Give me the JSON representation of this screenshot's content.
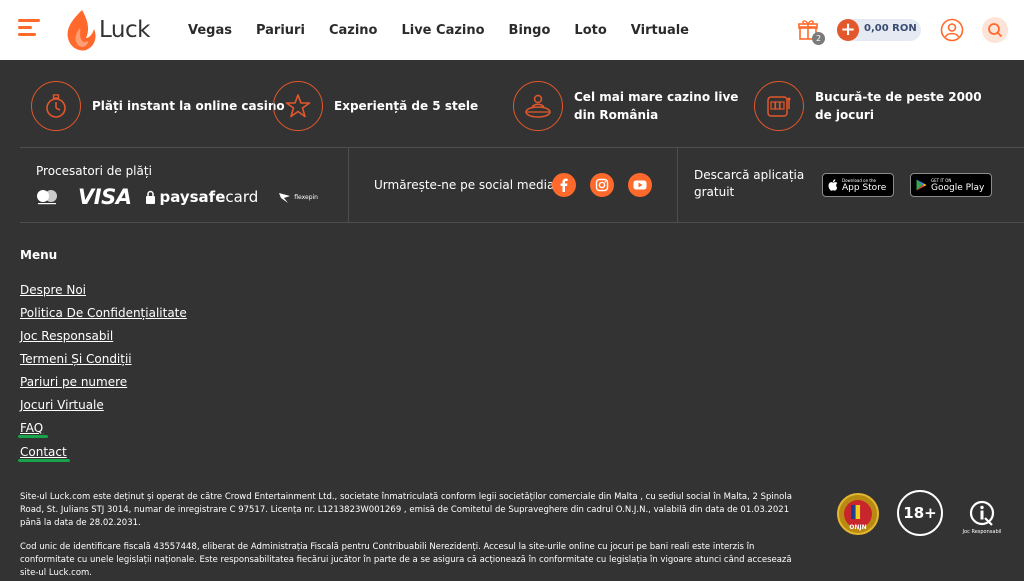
{
  "header": {
    "logo_text": "Luck",
    "nav": [
      "Vegas",
      "Pariuri",
      "Cazino",
      "Live Cazino",
      "Bingo",
      "Loto",
      "Virtuale"
    ],
    "gift_count": "2",
    "balance": "0,00 RON"
  },
  "features": [
    {
      "text": "Plăți instant la online casino",
      "icon": "stopwatch-icon"
    },
    {
      "text": "Experiență de 5 stele",
      "icon": "star-icon"
    },
    {
      "text": "Cel mai mare cazino live din România",
      "icon": "live-dealer-icon"
    },
    {
      "text": "Bucură-te de peste 2000 de jocuri",
      "icon": "slot-machine-icon"
    }
  ],
  "payments": {
    "title": "Procesatori de plăți",
    "visa": "VISA",
    "paysafe_bold": "paysafe",
    "paysafe_rest": "card",
    "flexepin": "flexepin"
  },
  "social": {
    "title": "Urmărește-ne pe social media",
    "icons": [
      "facebook-icon",
      "instagram-icon",
      "youtube-icon"
    ]
  },
  "app": {
    "title": "Descarcă aplicația gratuit",
    "appstore_small": "Download on the",
    "appstore_big": "App Store",
    "googleplay_small": "GET IT ON",
    "googleplay_big": "Google Play"
  },
  "menu": {
    "title": "Menu",
    "links": [
      "Despre Noi",
      "Politica De Confidențialitate",
      "Joc Responsabil",
      "Termeni Și Condiții",
      "Pariuri pe numere",
      "Jocuri Virtuale",
      "FAQ",
      "Contact"
    ]
  },
  "legal": {
    "para1": "Site-ul Luck.com este deținut și operat de către Crowd Entertainment Ltd., societate înmatriculată conform legii societăților comerciale din Malta , cu sediul social în Malta, 2 Spinola Road, St. Julians STJ 3014, numar de inregistrare C 97517. Licența nr. L1213823W001269 , emisă de Comitetul de Supraveghere din cadrul O.N.J.N., valabilă din data de 01.03.2021 până la data de 28.02.2031.",
    "para2": "Cod unic de identificare fiscală 43557448, eliberat de Administrația Fiscală pentru Contribuabili Nerezidenți. Accesul la site-urile online cu jocuri pe bani reali este interzis în conformitate cu unele legislații naționale. Este responsabilitatea fiecărui jucător în parte de a se asigura că acționează în conformitate cu legislația în vigoare atunci când accesează site-ul Luck.com."
  },
  "badges": {
    "onjn": "ONJN",
    "age": "18+",
    "responsible": "Joc Responsabil"
  },
  "colors": {
    "accent": "#ff6a2c",
    "footer_bg": "#333333",
    "annotation_green": "#16a34a"
  }
}
